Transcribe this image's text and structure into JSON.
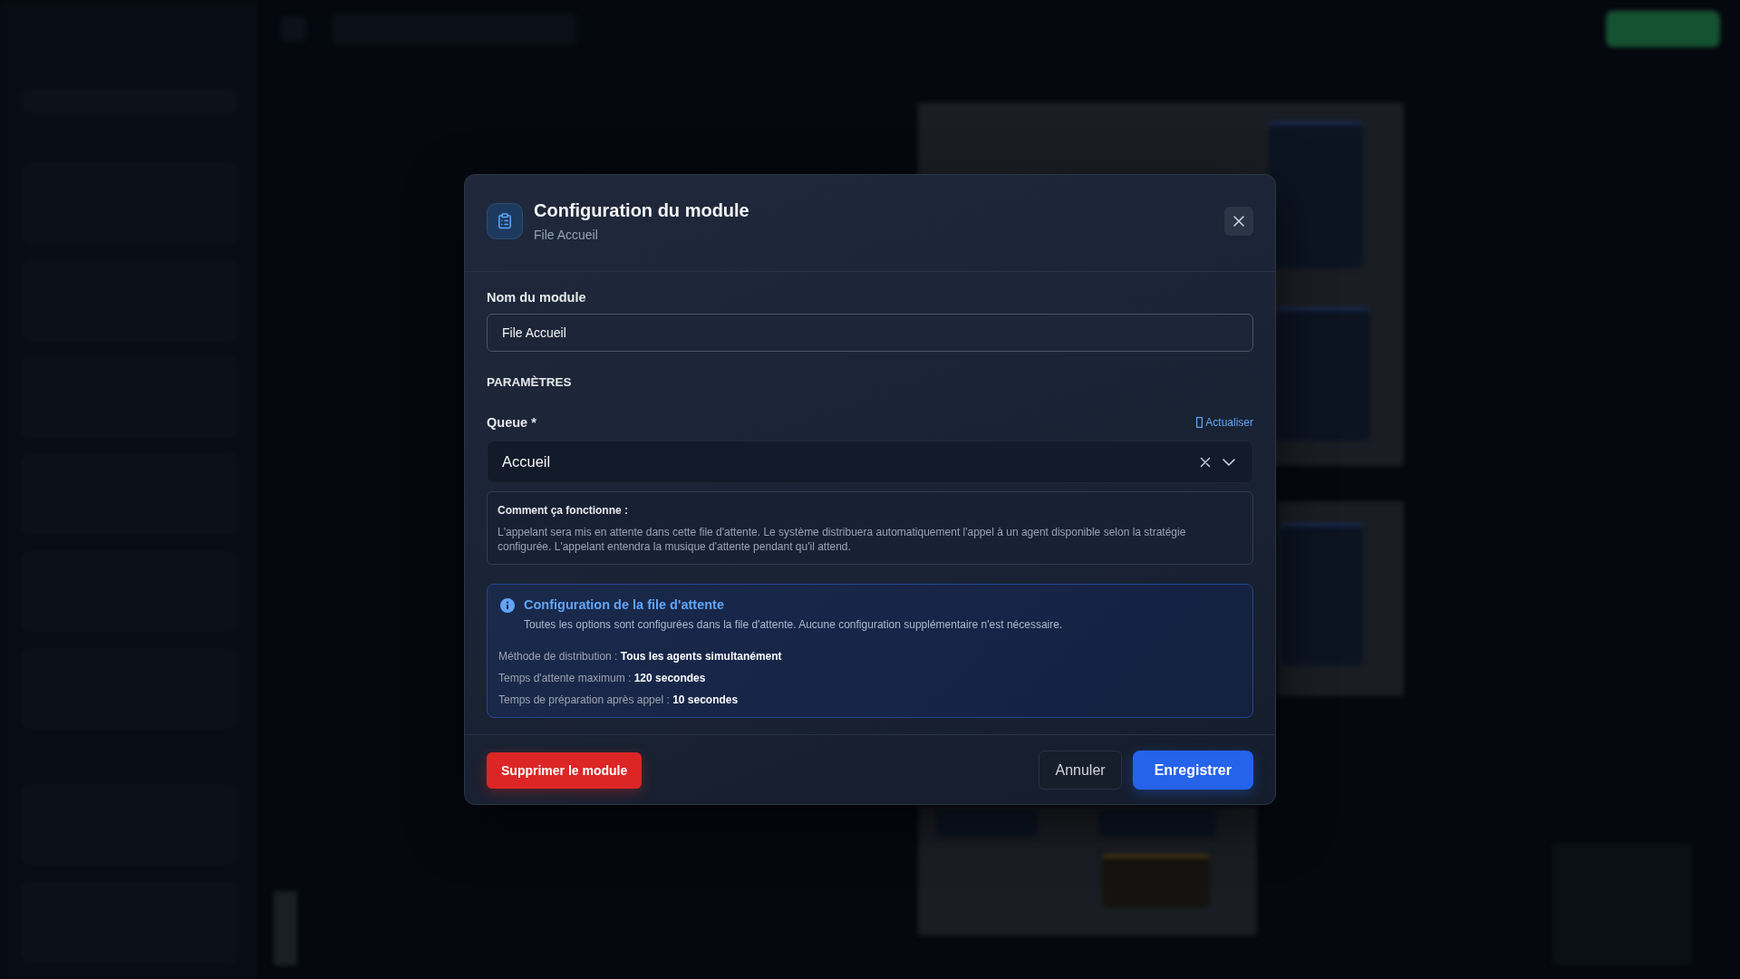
{
  "dialog": {
    "title": "Configuration du module",
    "subtitle": "File Accueil"
  },
  "module_name": {
    "label": "Nom du module",
    "value": "File Accueil"
  },
  "section_heading": "PARAMÈTRES",
  "queue": {
    "label": "Queue *",
    "refresh_link": "Actualiser",
    "value": "Accueil"
  },
  "how_it_works": {
    "title": "Comment ça fonctionne :",
    "text": "L'appelant sera mis en attente dans cette file d'attente. Le système distribuera automatiquement l'appel à un agent disponible selon la stratégie configurée. L'appelant entendra la musique d'attente pendant qu'il attend."
  },
  "queue_info": {
    "title": "Configuration de la file d'attente",
    "text": "Toutes les options sont configurées dans la file d'attente. Aucune configuration supplémentaire n'est nécessaire.",
    "details": [
      "Méthode de distribution : **Tous les agents simultanément**",
      "Temps d'attente maximum : **120 secondes**",
      "Temps de préparation après appel : **10 secondes**"
    ]
  },
  "footer": {
    "buttons": [
      {
        "label": "Supprimer le module",
        "kind": "danger"
      },
      {
        "label": "Annuler",
        "kind": "secondary"
      },
      {
        "label": "Enregistrer",
        "kind": "primary"
      }
    ]
  }
}
